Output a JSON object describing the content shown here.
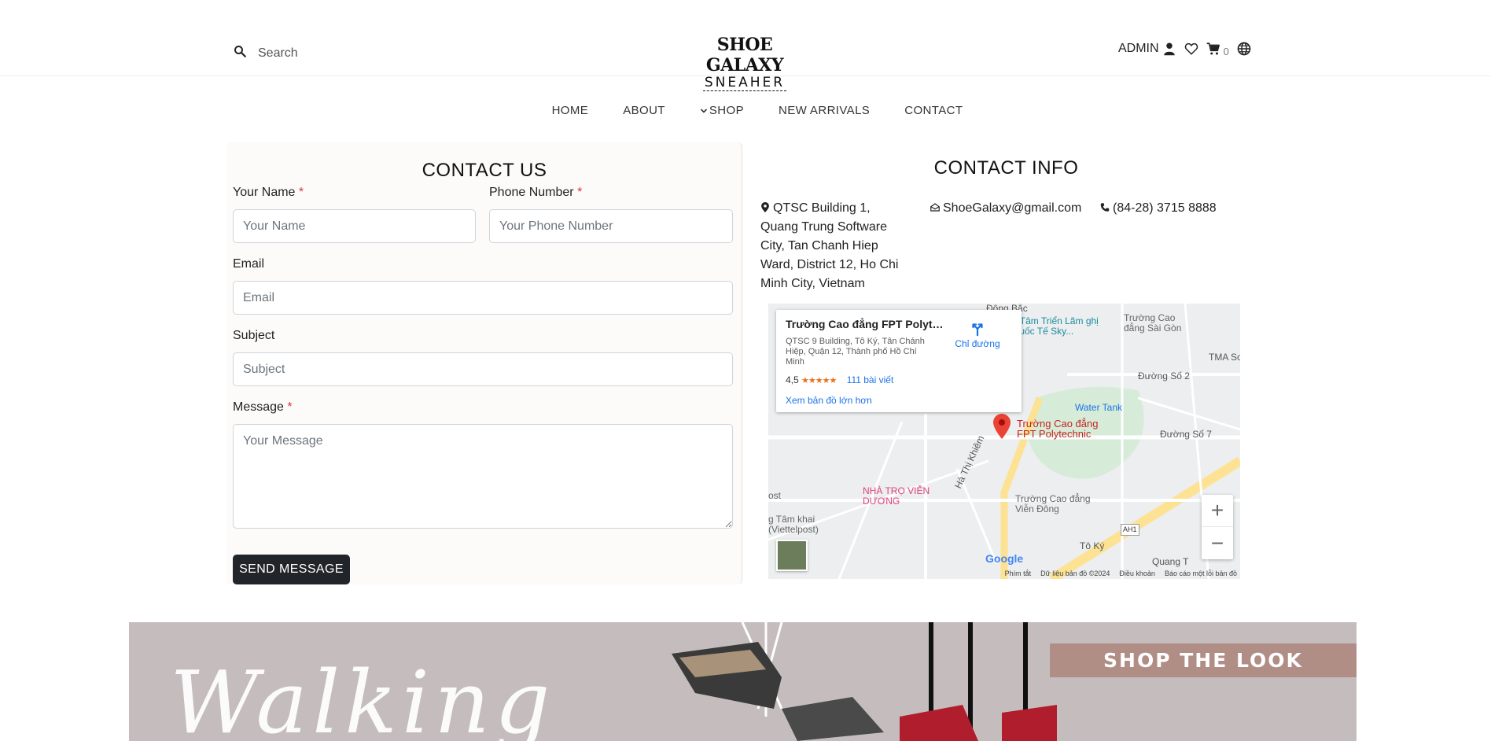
{
  "header": {
    "search_placeholder": "Search",
    "logo_title": "SHOE GALAXY",
    "logo_sub": "SNEAHER",
    "account_label": "ADMIN",
    "cart_count": "0"
  },
  "nav": {
    "home": "HOME",
    "about": "ABOUT",
    "shop": "SHOP",
    "new_arrivals": "NEW ARRIVALS",
    "contact": "CONTACT"
  },
  "contact_form": {
    "title": "CONTACT US",
    "name_label": "Your Name",
    "name_placeholder": "Your Name",
    "phone_label": "Phone Number",
    "phone_placeholder": "Your Phone Number",
    "email_label": "Email",
    "email_placeholder": "Email",
    "subject_label": "Subject",
    "subject_placeholder": "Subject",
    "message_label": "Message",
    "message_placeholder": "Your Message",
    "required_mark": "*",
    "send_label": "SEND MESSAGE"
  },
  "contact_info": {
    "title": "CONTACT INFO",
    "address": "QTSC Building 1, Quang Trung Software City, Tan Chanh Hiep Ward, District 12, Ho Chi Minh City, Vietnam",
    "email": "ShoeGalaxy@gmail.com",
    "phone": "(84-28) 3715 8888"
  },
  "map": {
    "place_name": "Trường Cao đẳng FPT Polytec...",
    "place_address": "QTSC 9 Building, Tô Ký, Tân Chánh Hiệp, Quận 12, Thành phố Hồ Chí Minh",
    "directions": "Chỉ đường",
    "rating": "4,5",
    "stars": "★★★★★",
    "reviews": "111 bài viết",
    "larger_map": "Xem bản đồ lớn hơn",
    "pin_label": "Trường Cao đẳng FPT Polytechnic",
    "labels": {
      "dong_bac": "Đông Bắc",
      "trien_lam": "g Tâm Triển Lãm ghị Quốc Tế Sky...",
      "cao_dang_sg": "Trường Cao đẳng Sài Gòn",
      "tma": "TMA So",
      "duong_so_2": "Đường Số 2",
      "water_tank": "Water Tank",
      "duong_so_7": "Đường Số 7",
      "ha_thi_khiem": "Hà Thị Khiêm",
      "nha_tro": "NHÀ TRỌ VIỄN DƯƠNG",
      "cao_dang_vd": "Trường Cao đẳng Viễn Đông",
      "to_ky": "Tô Ký",
      "quang_trung": "Quang T",
      "viettelpost": "g Tâm khai (Viettelpost)",
      "ost": "ost",
      "ah1": "AH1"
    },
    "footer_shortcuts": "Phím tắt",
    "footer_data": "Dữ liệu bản đồ ©2024",
    "footer_terms": "Điều khoản",
    "footer_report": "Báo cáo một lỗi bản đồ",
    "google": "Google"
  },
  "banner": {
    "script_text": "Walking",
    "shop_the_look": "SHOP THE LOOK"
  },
  "colors": {
    "button_dark": "#212529",
    "required_red": "#dc3545",
    "map_link_blue": "#1a73e8",
    "banner_bg": "#c5bdbd",
    "banner_tag": "#b08e86"
  }
}
